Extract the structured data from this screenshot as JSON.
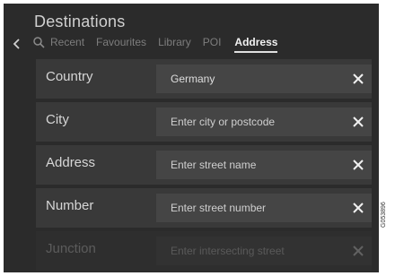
{
  "header": {
    "title": "Destinations"
  },
  "tabs": {
    "items": [
      {
        "label": "Recent"
      },
      {
        "label": "Favourites"
      },
      {
        "label": "Library"
      },
      {
        "label": "POI"
      },
      {
        "label": "Address",
        "active": true
      }
    ]
  },
  "form": {
    "rows": [
      {
        "label": "Country",
        "value": "Germany",
        "placeholder": ""
      },
      {
        "label": "City",
        "value": "",
        "placeholder": "Enter city or postcode"
      },
      {
        "label": "Address",
        "value": "",
        "placeholder": "Enter street name"
      },
      {
        "label": "Number",
        "value": "",
        "placeholder": "Enter street number"
      },
      {
        "label": "Junction",
        "value": "",
        "placeholder": "Enter intersecting street"
      }
    ]
  },
  "image_code": "G053896",
  "icons": {
    "back": "chevron-left-icon",
    "search": "search-icon",
    "clear": "close-icon"
  },
  "colors": {
    "background": "#2b2b2b",
    "row": "#393939",
    "field": "#454545",
    "active_tab": "#f2f2f2",
    "inactive_tab": "#7d7d7d"
  }
}
